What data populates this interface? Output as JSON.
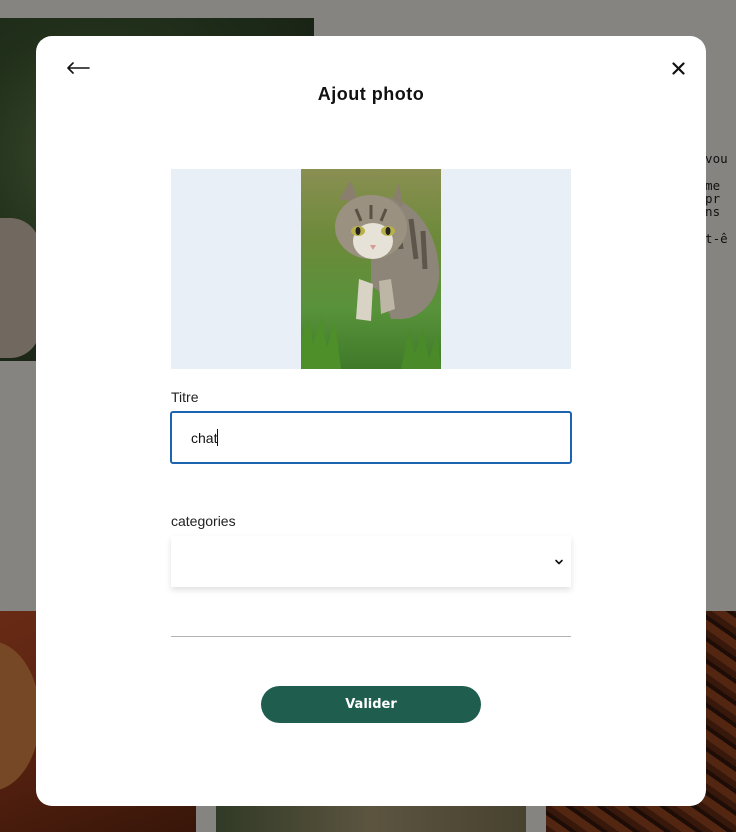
{
  "background": {
    "text_lines": [
      "e vou",
      "",
      "à me",
      "espr",
      "dans",
      "",
      "eut-ê"
    ]
  },
  "modal": {
    "back_icon": "arrow-left-icon",
    "close_icon": "close-icon",
    "title": "Ajout photo",
    "photo": {
      "subject": "tabby-cat-photo"
    },
    "title_field": {
      "label": "Titre",
      "value": "chat"
    },
    "category_field": {
      "label": "categories",
      "selected": "",
      "icon": "chevron-down-icon"
    },
    "submit_label": "Valider"
  },
  "colors": {
    "accent_button": "#1f5e4f",
    "input_focus_border": "#1d64b0",
    "photo_area_bg": "#e8eff6"
  }
}
